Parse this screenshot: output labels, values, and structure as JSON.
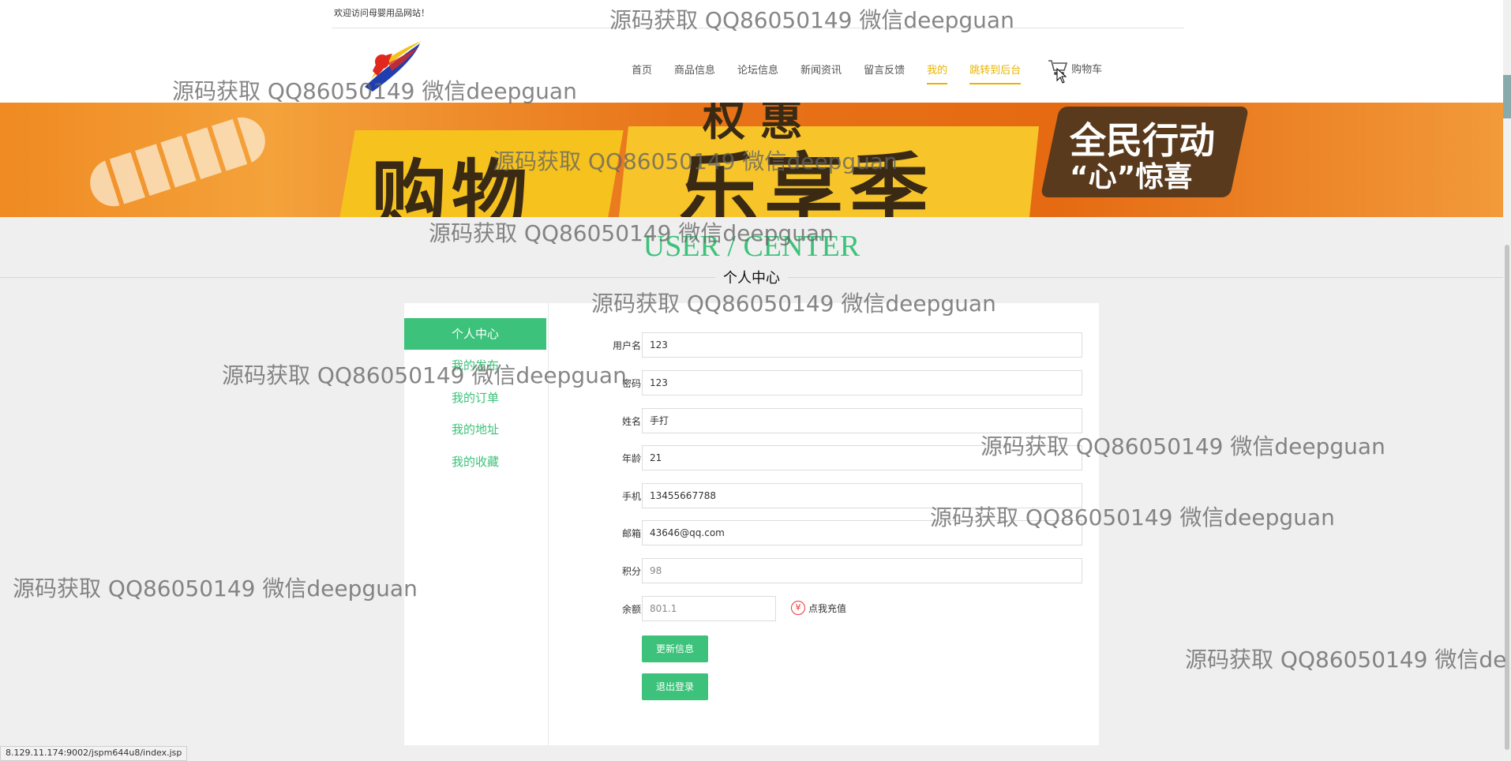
{
  "header": {
    "welcome": "欢迎访问母婴用品网站！",
    "nav": [
      {
        "label": "首页",
        "active": false
      },
      {
        "label": "商品信息",
        "active": false
      },
      {
        "label": "论坛信息",
        "active": false
      },
      {
        "label": "新闻资讯",
        "active": false
      },
      {
        "label": "留言反馈",
        "active": false
      },
      {
        "label": "我的",
        "active": true
      },
      {
        "label": "跳转到后台",
        "active": true
      }
    ],
    "cart_label": "购物车",
    "cart_icon": "cart-icon"
  },
  "banner": {
    "text1": "购物",
    "text2": "乐享季",
    "text3": "全民行动",
    "text4": "“心”惊喜",
    "text5": "权 惠"
  },
  "section": {
    "title_en": "USER / CENTER",
    "title_cn": "个人中心"
  },
  "sidebar": {
    "items": [
      {
        "label": "个人中心",
        "active": true
      },
      {
        "label": "我的发布",
        "active": false
      },
      {
        "label": "我的订单",
        "active": false
      },
      {
        "label": "我的地址",
        "active": false
      },
      {
        "label": "我的收藏",
        "active": false
      }
    ]
  },
  "form": {
    "username_label": "用户名",
    "username_value": "123",
    "password_label": "密码",
    "password_value": "123",
    "name_label": "姓名",
    "name_value": "手打",
    "age_label": "年龄",
    "age_value": "21",
    "phone_label": "手机",
    "phone_value": "13455667788",
    "email_label": "邮箱",
    "email_value": "43646@qq.com",
    "points_label": "积分",
    "points_value": "98",
    "balance_label": "余额",
    "balance_value": "801.1",
    "recharge_label": "点我充值",
    "recharge_symbol": "¥"
  },
  "buttons": {
    "update": "更新信息",
    "logout": "退出登录"
  },
  "statusbar": {
    "url": "8.129.11.174:9002/jspm644u8/index.jsp"
  },
  "watermark": {
    "text": "源码获取 QQ86050149 微信deepguan",
    "text_partial": "源码获取 QQ86050149 微信de"
  },
  "colors": {
    "accent": "#3cc27a",
    "nav_active": "#e8b400",
    "background": "#efefef"
  }
}
